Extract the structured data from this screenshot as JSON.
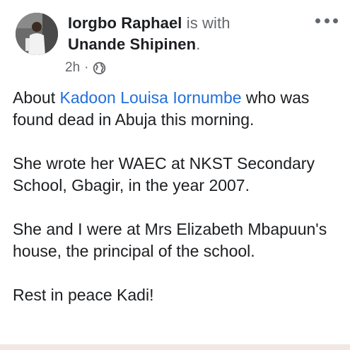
{
  "post": {
    "author": "Iorgbo Raphael",
    "with_text": "is with",
    "tagged": "Unande Shipinen",
    "tagged_suffix": ".",
    "time": "2h",
    "separator": "·",
    "privacy_icon": "globe-icon",
    "more_icon": "more-options-icon",
    "paragraphs": [
      {
        "prefix": "About ",
        "mention": "Kadoon Louisa Iornumbe",
        "suffix": " who was found dead in Abuja this morning."
      },
      {
        "text": "She wrote her WAEC at NKST Secondary School, Gbagir, in the year 2007."
      },
      {
        "text": "She and I were at Mrs Elizabeth Mbapuun's house, the principal of the school."
      },
      {
        "text": "Rest in peace Kadi!"
      }
    ]
  },
  "colors": {
    "link": "#216fdb",
    "meta": "#65676b",
    "text": "#1c1e21"
  }
}
